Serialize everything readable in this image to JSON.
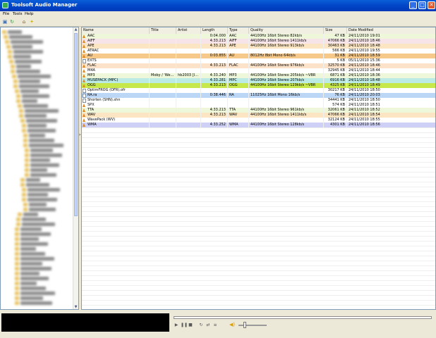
{
  "window": {
    "title": "Toolsoft Audio Manager",
    "controls": {
      "minimize": "_",
      "maximize": "□",
      "close": "✕"
    }
  },
  "menu": [
    "File",
    "Tools",
    "Help"
  ],
  "toolbar_icons": [
    "add-folder-icon",
    "refresh-icon",
    "home-icon",
    "tip-icon"
  ],
  "colors": {
    "header_bg": "#F1EFE2",
    "titlebar": "#0A5FD8",
    "row_green": "#EEF7D9",
    "row_pink": "#F7E4E9",
    "row_orange": "#FBD9A8",
    "row_deep_orange": "#F6C98A",
    "row_teal": "#BCEBE5",
    "row_yellowgreen": "#C7E84A",
    "row_blue": "#BCD7F5",
    "row_lavender": "#CED0F5"
  },
  "grid": {
    "columns": [
      "Name",
      "Title",
      "Artist",
      "Length",
      "Type",
      "Quality",
      "Size",
      "Date Modified"
    ],
    "rows": [
      {
        "name": "AAC",
        "title": "",
        "artist": "",
        "length": "0:04.000",
        "type": "AAC",
        "quality": "44100Hz 16bit Stereo 82kb/s",
        "size": "47 KB",
        "date": "24/11/2010 19:01",
        "color": "#EEF7D9",
        "icon": "audio"
      },
      {
        "name": "AIFF",
        "title": "",
        "artist": "",
        "length": "4:33.213",
        "type": "AIFF",
        "quality": "44100Hz 16bit Stereo 1411kb/s",
        "size": "47066 KB",
        "date": "24/11/2010 18:46",
        "color": "#F7E4E9",
        "icon": "audio"
      },
      {
        "name": "APE",
        "title": "",
        "artist": "",
        "length": "4:33.213",
        "type": "APE",
        "quality": "44100Hz 16bit Stereo 913kb/s",
        "size": "30463 KB",
        "date": "24/11/2010 18:48",
        "color": "#FBE5C2",
        "icon": "audio"
      },
      {
        "name": "ATRAC",
        "title": "",
        "artist": "",
        "length": "",
        "type": "",
        "quality": "",
        "size": "566 KB",
        "date": "24/11/2010 19:55",
        "color": "#FFFFFF",
        "icon": "audio"
      },
      {
        "name": "AU",
        "title": "",
        "artist": "",
        "length": "0:03.855",
        "type": "AU",
        "quality": "8012Hz 8bit Mono 64kb/s",
        "size": "31 KB",
        "date": "24/11/2010 18:59",
        "color": "#F6C98A",
        "icon": "audio"
      },
      {
        "name": "EXTS",
        "title": "",
        "artist": "",
        "length": "",
        "type": "",
        "quality": "",
        "size": "5 KB",
        "date": "05/11/2010 15:36",
        "color": "#FFFFFF",
        "icon": "doc"
      },
      {
        "name": "FLAC",
        "title": "",
        "artist": "",
        "length": "4:33.213",
        "type": "FLAC",
        "quality": "44100Hz 16bit Stereo 976kb/s",
        "size": "32570 KB",
        "date": "24/11/2010 18:46",
        "color": "#FBE2C8",
        "icon": "audio"
      },
      {
        "name": "M4A",
        "title": "",
        "artist": "",
        "length": "",
        "type": "",
        "quality": "",
        "size": "32945 KB",
        "date": "24/11/2010 18:44",
        "color": "#FFFFFF",
        "icon": "audio"
      },
      {
        "name": "MP3",
        "title": "Moby / 'We…",
        "artist": "hb2003 [l…",
        "length": "4:33.240",
        "type": "MP3",
        "quality": "44100Hz 16bit Stereo 205kb/s ~VBR",
        "size": "6871 KB",
        "date": "24/11/2010 18:36",
        "color": "#EEF7D9",
        "icon": "audio"
      },
      {
        "name": "MUSEPACK (MPC)",
        "title": "",
        "artist": "",
        "length": "4:33.281",
        "type": "MPC",
        "quality": "44100Hz 16bit Stereo 207kb/s",
        "size": "6916 KB",
        "date": "24/11/2010 18:48",
        "color": "#BCEBE5",
        "icon": "audio"
      },
      {
        "name": "OGG",
        "title": "",
        "artist": "",
        "length": "4:33.213",
        "type": "OGG",
        "quality": "44100Hz 16bit Stereo 129kb/s ~VBR",
        "size": "4325 KB",
        "date": "24/11/2010 18:49",
        "color": "#C7E84A",
        "icon": "audio"
      },
      {
        "name": "OptimFROG (OFR).ofr",
        "title": "",
        "artist": "",
        "length": "",
        "type": "",
        "quality": "",
        "size": "30217 KB",
        "date": "24/11/2010 18:50",
        "color": "#FFFFFF",
        "icon": "doc"
      },
      {
        "name": "RA.ra",
        "title": "",
        "artist": "",
        "length": "0:38.446",
        "type": "RA",
        "quality": "11025Hz 16bit Mono 16kb/s",
        "size": "76 KB",
        "date": "24/11/2010 20:03",
        "color": "#BCD7F5",
        "icon": "doc"
      },
      {
        "name": "Shorten (SHN).shn",
        "title": "",
        "artist": "",
        "length": "",
        "type": "",
        "quality": "",
        "size": "34441 KB",
        "date": "24/11/2010 18:50",
        "color": "#FFFFFF",
        "icon": "doc"
      },
      {
        "name": "SPX",
        "title": "",
        "artist": "",
        "length": "",
        "type": "",
        "quality": "",
        "size": "574 KB",
        "date": "24/11/2010 18:51",
        "color": "#FFFFFF",
        "icon": "audio"
      },
      {
        "name": "TTA",
        "title": "",
        "artist": "",
        "length": "4:33.213",
        "type": "TTA",
        "quality": "44100Hz 16bit Stereo 961kb/s",
        "size": "32061 KB",
        "date": "24/11/2010 18:52",
        "color": "#EEF7D9",
        "icon": "audio"
      },
      {
        "name": "WAV",
        "title": "",
        "artist": "",
        "length": "4:33.213",
        "type": "WAV",
        "quality": "44100Hz 16bit Stereo 1411kb/s",
        "size": "47066 KB",
        "date": "24/11/2010 18:54",
        "color": "#FBE5C2",
        "icon": "audio"
      },
      {
        "name": "WavePack (WV)",
        "title": "",
        "artist": "",
        "length": "",
        "type": "",
        "quality": "",
        "size": "32124 KB",
        "date": "24/11/2010 18:55",
        "color": "#FFFFFF",
        "icon": "audio"
      },
      {
        "name": "WMA",
        "title": "",
        "artist": "",
        "length": "4:33.252",
        "type": "WMA",
        "quality": "44100Hz 16bit Stereo 128kb/s",
        "size": "4301 KB",
        "date": "24/11/2010 18:56",
        "color": "#CED0F5",
        "icon": "audio"
      }
    ]
  },
  "player": {
    "buttons": [
      "play-icon",
      "pause-icon",
      "stop-icon",
      "repeat-icon",
      "shuffle-icon",
      "playlist-icon"
    ],
    "volume_level": 0.2
  }
}
